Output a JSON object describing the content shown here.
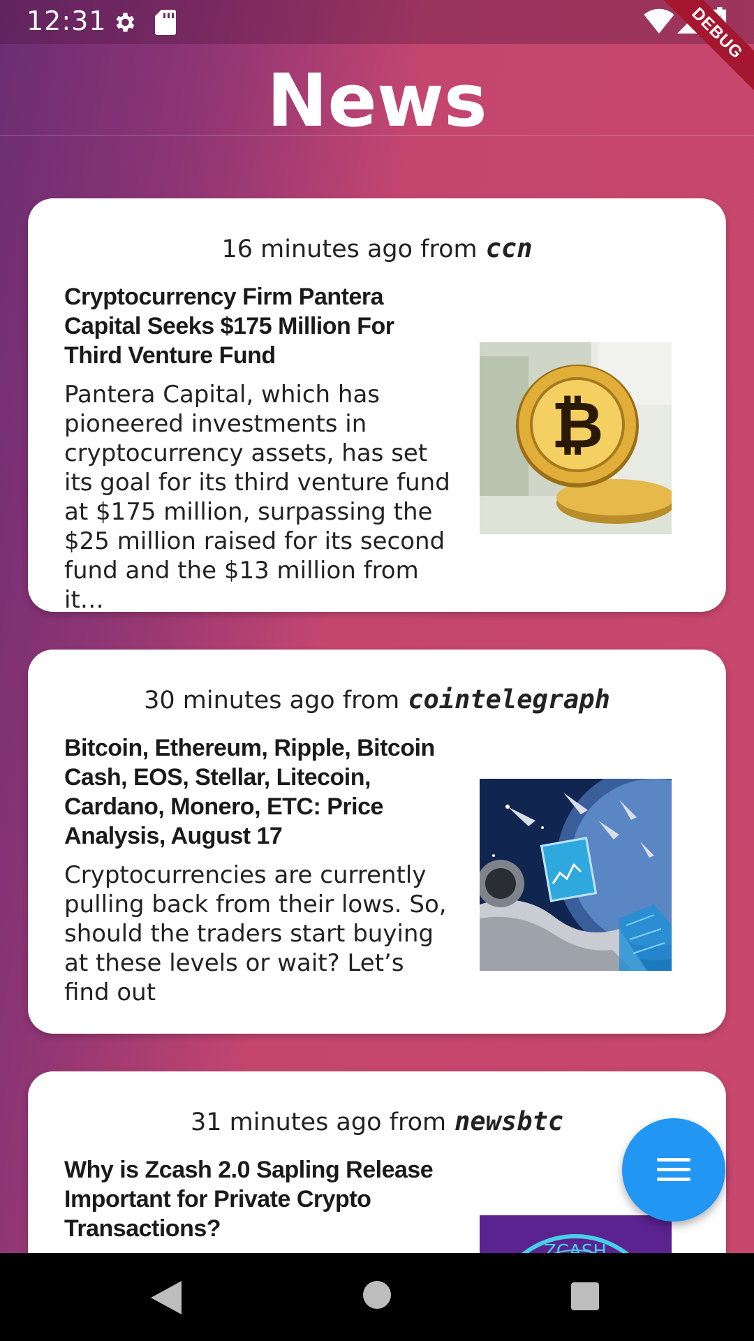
{
  "status_bar": {
    "time": "12:31",
    "icons_left": [
      "gear-icon",
      "sd-card-icon"
    ],
    "icons_right": [
      "wifi-icon",
      "signal-icon",
      "battery-icon"
    ],
    "debug_label": "DEBUG"
  },
  "app_bar": {
    "title": "News"
  },
  "articles": [
    {
      "time_ago": "16 minutes ago from",
      "source": "ccn",
      "title": "Cryptocurrency Firm Pantera Capital Seeks $175 Million For Third Venture Fund",
      "body": "Pantera Capital, which has pioneered investments in cryptocurrency assets, has set its goal for its third venture fund at $175 million, surpassing the $25 million raised for its second fund and the $13 million from it…",
      "image": "bitcoin-coin-on-dollars"
    },
    {
      "time_ago": "30 minutes ago from",
      "source": "cointelegraph",
      "title": "Bitcoin, Ethereum, Ripple, Bitcoin Cash, EOS, Stellar, Litecoin, Cardano, Monero, ETC: Price Analysis, August 17",
      "body": "Cryptocurrencies are currently pulling back from their lows. So, should the traders start buying at these levels or wait? Let’s find out",
      "image": "astronaut-with-chart"
    },
    {
      "time_ago": "31 minutes ago from",
      "source": "newsbtc",
      "title": "Why is Zcash 2.0 Sapling Release Important for Private Crypto Transactions?",
      "body": "",
      "image": "zcash-logo"
    }
  ],
  "fab": {
    "icon": "menu-icon"
  },
  "nav_bar": {
    "icons": [
      "back-icon",
      "home-icon",
      "recents-icon"
    ]
  },
  "colors": {
    "gradient_start": "#6b2d73",
    "gradient_end": "#c8476d",
    "fab": "#2196f3",
    "card": "#ffffff"
  }
}
